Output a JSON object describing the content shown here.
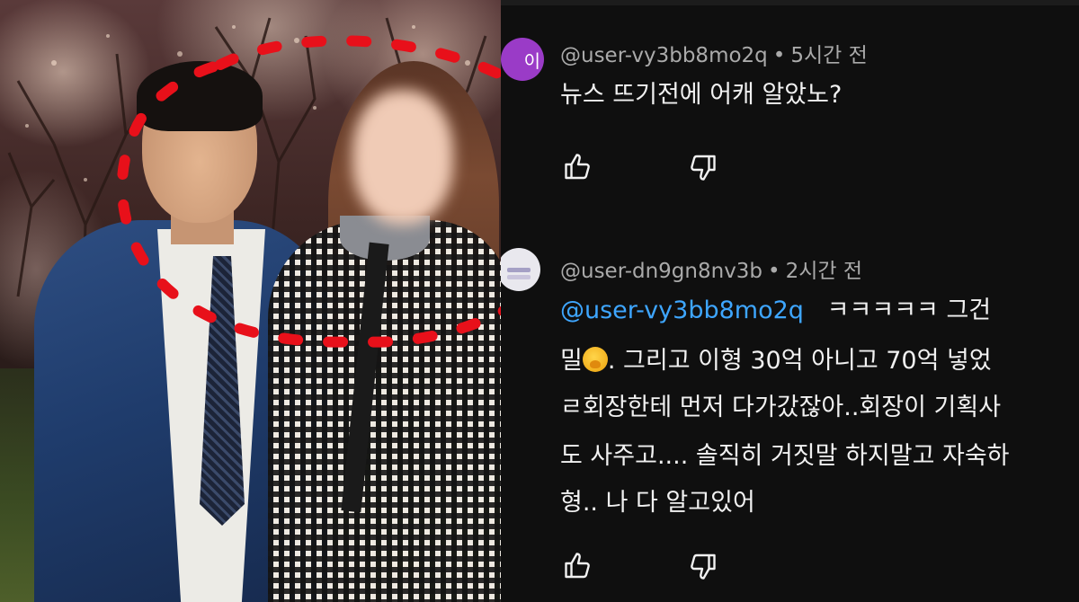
{
  "photo": {
    "description_icon": "couple-photo"
  },
  "comments": [
    {
      "avatar_initial": "이",
      "avatar_color": "#9a3bc7",
      "handle": "@user-vy3bb8mo2q",
      "time": "5시간 전",
      "separator": "•",
      "lines": [
        "뉴스 뜨기전에 어캐 알았노?"
      ],
      "like_icon": "thumbs-up-icon",
      "dislike_icon": "thumbs-down-icon"
    },
    {
      "avatar_color": "#e9e8ee",
      "handle": "@user-dn9gn8nv3b",
      "time": "2시간 전",
      "separator": "•",
      "mention": "@user-vy3bb8mo2q",
      "line1_rest": "ㅋㅋㅋㅋㅋ 그건",
      "line2_prefix": "밀",
      "line2_emoji": "shushing-face-emoji",
      "line2_rest": ". 그리고 이형 30억 아니고 70억 넣었",
      "line3": "ㄹ회장한테 먼저 다가갔잖아..회장이 기획사",
      "line4": "도 사주고.... 솔직히 거짓말 하지말고 자숙하",
      "line5": "형.. 나 다 알고있어",
      "like_icon": "thumbs-up-icon",
      "dislike_icon": "thumbs-down-icon"
    }
  ],
  "colors": {
    "background": "#0f0f0f",
    "text": "#f1f1f1",
    "meta": "#aaaaaa",
    "mention": "#3ea6ff",
    "circle_mark": "#e8101a"
  }
}
